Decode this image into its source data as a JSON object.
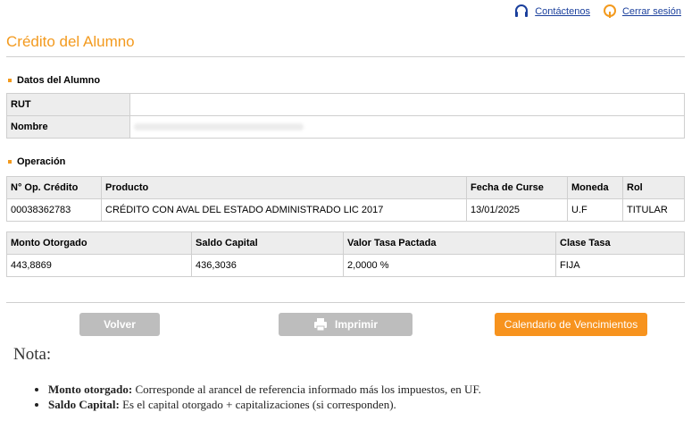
{
  "header": {
    "contact_label": "Contáctenos",
    "logout_label": "Cerrar sesión",
    "contact_icon": "headset-icon",
    "logout_icon": "power-icon"
  },
  "page": {
    "title": "Crédito del Alumno"
  },
  "student": {
    "section_title": "Datos del Alumno",
    "rut_label": "RUT",
    "rut_value": "",
    "name_label": "Nombre",
    "name_value": ""
  },
  "operation": {
    "section_title": "Operación",
    "columns": [
      "N° Op. Crédito",
      "Producto",
      "Fecha de Curse",
      "Moneda",
      "Rol"
    ],
    "row": [
      "00038362783",
      "CRÉDITO CON AVAL DEL ESTADO ADMINISTRADO LIC 2017",
      "13/01/2025",
      "U.F",
      "TITULAR"
    ]
  },
  "amounts": {
    "columns": [
      "Monto Otorgado",
      "Saldo Capital",
      "Valor Tasa Pactada",
      "Clase Tasa"
    ],
    "row": [
      "443,8869",
      "436,3036",
      "2,0000 %",
      "FIJA"
    ]
  },
  "actions": {
    "back_label": "Volver",
    "print_label": "Imprimir",
    "calendar_label": "Calendario de Vencimientos"
  },
  "note": {
    "title": "Nota:",
    "items": [
      {
        "term": "Monto otorgado:",
        "text": " Corresponde al arancel de referencia informado más los impuestos, en UF."
      },
      {
        "term": "Saldo Capital:",
        "text": " Es el capital otorgado + capitalizaciones (si corresponden)."
      }
    ]
  },
  "colors": {
    "accent": "#f39a1e",
    "link": "#1a3f9c",
    "button_gray": "#bdbdbd",
    "button_orange": "#f7931e"
  }
}
